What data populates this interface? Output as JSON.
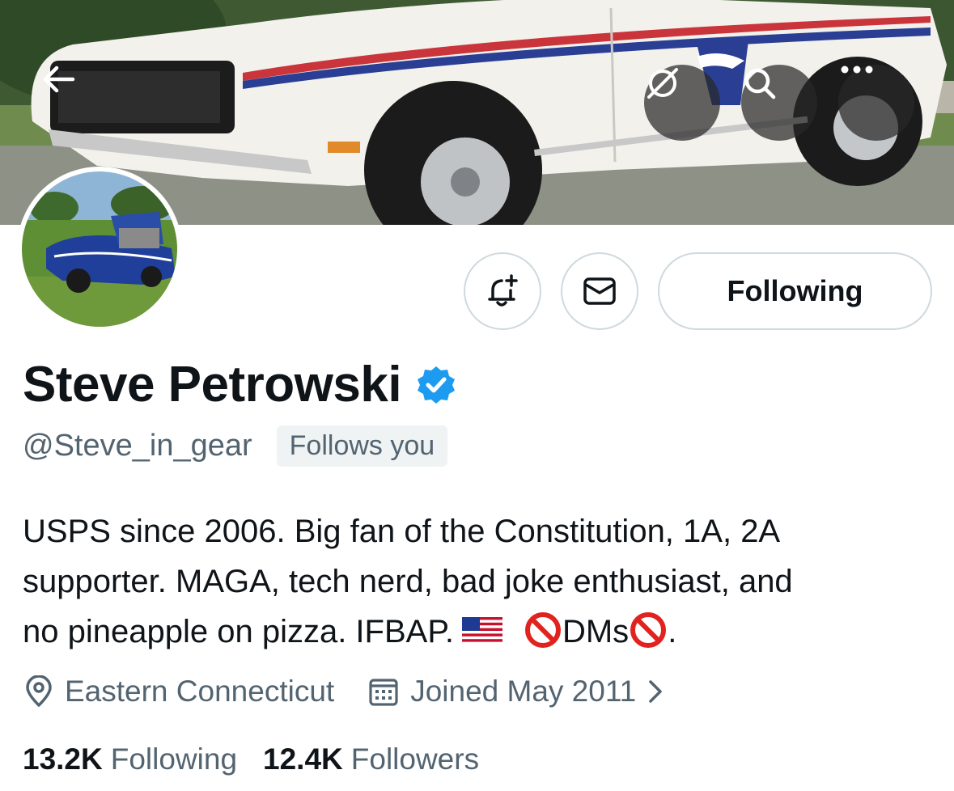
{
  "profile": {
    "display_name": "Steve Petrowski",
    "handle": "@Steve_in_gear",
    "follows_you": "Follows you",
    "bio_lines": [
      "USPS since 2006. Big fan of the Constitution, 1A, 2A",
      "supporter. MAGA, tech nerd, bad joke enthusiast, and",
      "no pineapple on pizza. IFBAP."
    ],
    "bio_dms": "DMs",
    "bio_end": ".",
    "location": "Eastern Connecticut",
    "joined": "Joined May 2011"
  },
  "actions": {
    "following_label": "Following"
  },
  "stats": {
    "following_count": "13.2K",
    "following_label": "Following",
    "followers_count": "12.4K",
    "followers_label": "Followers"
  },
  "icons": {
    "back": "arrow-left-icon",
    "grok": "grok-icon",
    "search": "search-icon",
    "more": "more-icon",
    "notify": "bell-plus-icon",
    "message": "envelope-icon",
    "verified": "verified-badge-icon",
    "location": "location-pin-icon",
    "calendar": "calendar-icon",
    "chevron": "chevron-right-icon"
  },
  "colors": {
    "accent": "#1d9bf0",
    "text_primary": "#0f1419",
    "text_secondary": "#536471",
    "border": "#cfd9de",
    "badge_bg": "#eff3f4"
  }
}
